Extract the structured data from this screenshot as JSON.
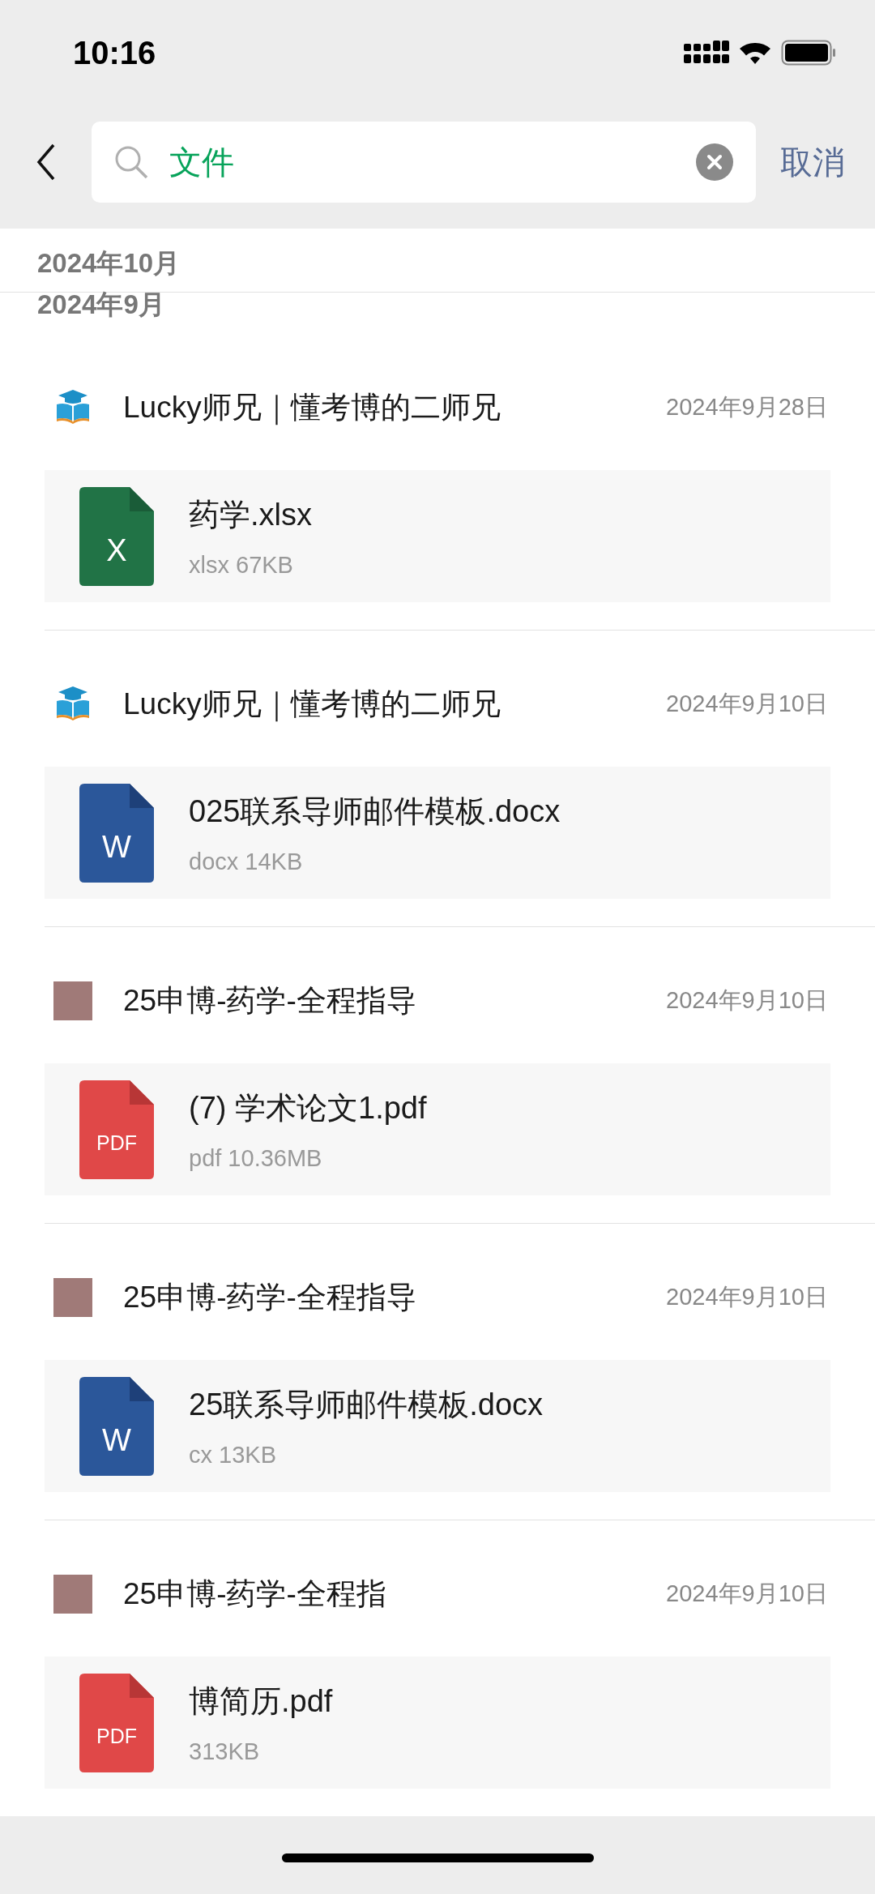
{
  "status_bar": {
    "time": "10:16"
  },
  "search": {
    "value": "文件",
    "cancel": "取消"
  },
  "months": [
    "2024年10月",
    "2024年9月"
  ],
  "groups": [
    {
      "sender": "Lucky师兄｜懂考博的二师兄",
      "avatar": {
        "kind": "logo"
      },
      "date": "2024年9月28日",
      "file": {
        "kind": "xlsx",
        "icon_label": "X",
        "name": "药学.xlsx",
        "size": "xlsx 67KB"
      }
    },
    {
      "sender": "Lucky师兄｜懂考博的二师兄",
      "avatar": {
        "kind": "logo"
      },
      "date": "2024年9月10日",
      "file": {
        "kind": "docx",
        "icon_label": "W",
        "name": "025联系导师邮件模板.docx",
        "size": "docx 14KB"
      }
    },
    {
      "sender": "25申博-药学-全程指导",
      "avatar": {
        "kind": "plain"
      },
      "date": "2024年9月10日",
      "file": {
        "kind": "pdf",
        "icon_label": "PDF",
        "name": "(7) 学术论文1.pdf",
        "size": "pdf 10.36MB"
      }
    },
    {
      "sender": "25申博-药学-全程指导",
      "avatar": {
        "kind": "plain"
      },
      "date": "2024年9月10日",
      "file": {
        "kind": "docx",
        "icon_label": "W",
        "name": "25联系导师邮件模板.docx",
        "size": "cx 13KB"
      }
    },
    {
      "sender": "25申博-药学-全程指",
      "avatar": {
        "kind": "plain"
      },
      "date": "2024年9月10日",
      "file": {
        "kind": "pdf",
        "icon_label": "PDF",
        "name": "博简历.pdf",
        "size": "313KB"
      }
    }
  ]
}
